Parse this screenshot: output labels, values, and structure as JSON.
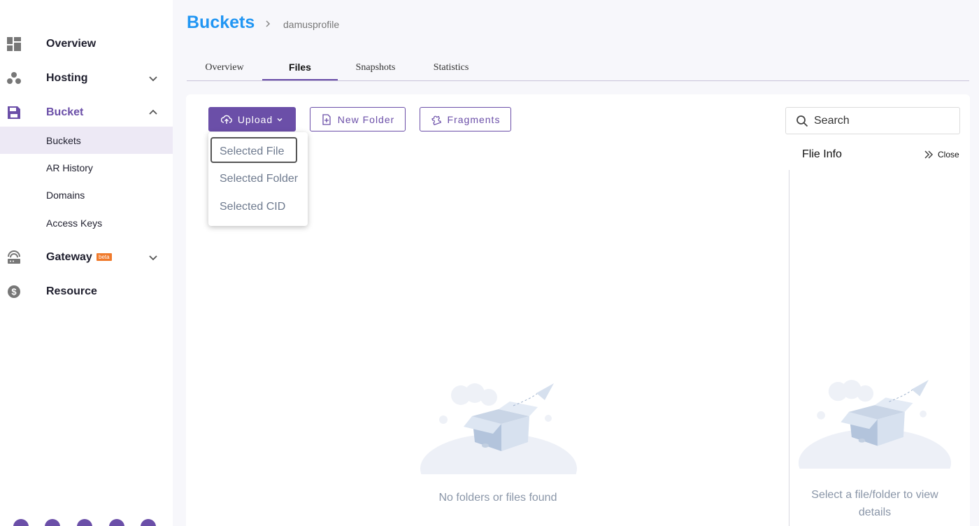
{
  "sidebar": {
    "items": [
      {
        "label": "Overview",
        "icon": "dashboard-icon"
      },
      {
        "label": "Hosting",
        "icon": "hosting-icon"
      },
      {
        "label": "Bucket",
        "icon": "bucket-icon"
      },
      {
        "label": "Gateway",
        "icon": "gateway-icon",
        "badge": "beta"
      },
      {
        "label": "Resource",
        "icon": "dollar-icon"
      }
    ],
    "bucket_subitems": [
      {
        "label": "Buckets"
      },
      {
        "label": "AR History"
      },
      {
        "label": "Domains"
      },
      {
        "label": "Access Keys"
      }
    ],
    "accent_color": "#6b4fa8",
    "badge_color": "#f07a2b"
  },
  "header": {
    "title": "Buckets",
    "breadcrumb": "damusprofile",
    "title_color": "#2196f3"
  },
  "tabs": [
    {
      "label": "Overview"
    },
    {
      "label": "Files"
    },
    {
      "label": "Snapshots"
    },
    {
      "label": "Statistics"
    }
  ],
  "toolbar": {
    "upload_label": "Upload",
    "new_folder_label": "New Folder",
    "fragments_label": "Fragments"
  },
  "upload_menu": {
    "items": [
      {
        "label": "Selected File"
      },
      {
        "label": "Selected Folder"
      },
      {
        "label": "Selected CID"
      }
    ]
  },
  "search": {
    "placeholder": "Search"
  },
  "file_info": {
    "title": "Flie Info",
    "close_label": "Close",
    "empty_text": "Select a file/folder to view details"
  },
  "files": {
    "empty_text": "No folders or files found"
  }
}
